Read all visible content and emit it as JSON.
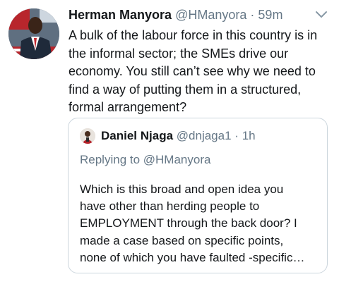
{
  "tweet": {
    "display_name": "Herman Manyora",
    "handle": "@HManyora",
    "separator": "·",
    "time": "59m",
    "text_lines": [
      "A bulk of the labour force in this country is in",
      "the informal sector; the SMEs drive our",
      "economy. You still can’t see why we need to",
      "find a way of putting them in a structured,",
      "formal arrangement?"
    ],
    "avatar_icon": "profile-photo",
    "menu_icon": "chevron-down-icon"
  },
  "quoted_tweet": {
    "display_name": "Daniel Njaga",
    "handle": "@dnjaga1",
    "separator": "·",
    "time": "1h",
    "replying_to": "Replying to @HManyora",
    "text_lines": [
      "Which is this broad and open idea you",
      "have other than herding people to",
      "EMPLOYMENT through the back door? I",
      "made a case based on specific points,",
      "none of which you have faulted -specific…"
    ],
    "avatar_icon": "profile-photo"
  },
  "colors": {
    "text_primary": "#14171a",
    "text_secondary": "#657786",
    "border": "#ccd6dd"
  }
}
